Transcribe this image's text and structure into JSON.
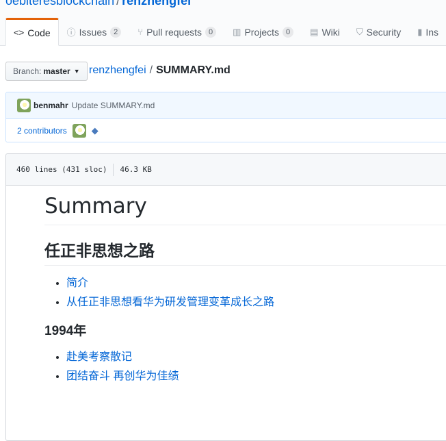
{
  "breadcrumb": {
    "owner": "oebiteresblockchain",
    "separator": "/",
    "repo": "renzhengfei"
  },
  "tabs": [
    {
      "label": "Code",
      "icon": "code-icon",
      "selected": true
    },
    {
      "label": "Issues",
      "icon": "issue-icon",
      "count": "2"
    },
    {
      "label": "Pull requests",
      "icon": "pull-request-icon",
      "count": "0"
    },
    {
      "label": "Projects",
      "icon": "project-icon",
      "count": "0"
    },
    {
      "label": "Wiki",
      "icon": "book-icon"
    },
    {
      "label": "Security",
      "icon": "shield-icon"
    },
    {
      "label": "Ins",
      "icon": "graph-icon"
    }
  ],
  "branch": {
    "label": "Branch:",
    "value": "master"
  },
  "file_path": {
    "root": "renzhengfei",
    "separator": "/",
    "file": "SUMMARY.md"
  },
  "commit": {
    "author": "benmahr",
    "message": "Update SUMMARY.md",
    "contributors": "2 contributors"
  },
  "file_info": {
    "lines": "460 lines (431 sloc)",
    "size": "46.3 KB"
  },
  "markdown": {
    "h1": "Summary",
    "h2": "任正非思想之路",
    "list1": [
      "简介",
      "从任正非思想看华为研发管理变革成长之路"
    ],
    "h3": "1994年",
    "list2": [
      "赴美考察散记",
      "团结奋斗 再创华为佳绩"
    ]
  },
  "colors": {
    "link": "#0366d6",
    "tab_accent": "#e36209",
    "commit_bg": "#f1f8ff"
  }
}
